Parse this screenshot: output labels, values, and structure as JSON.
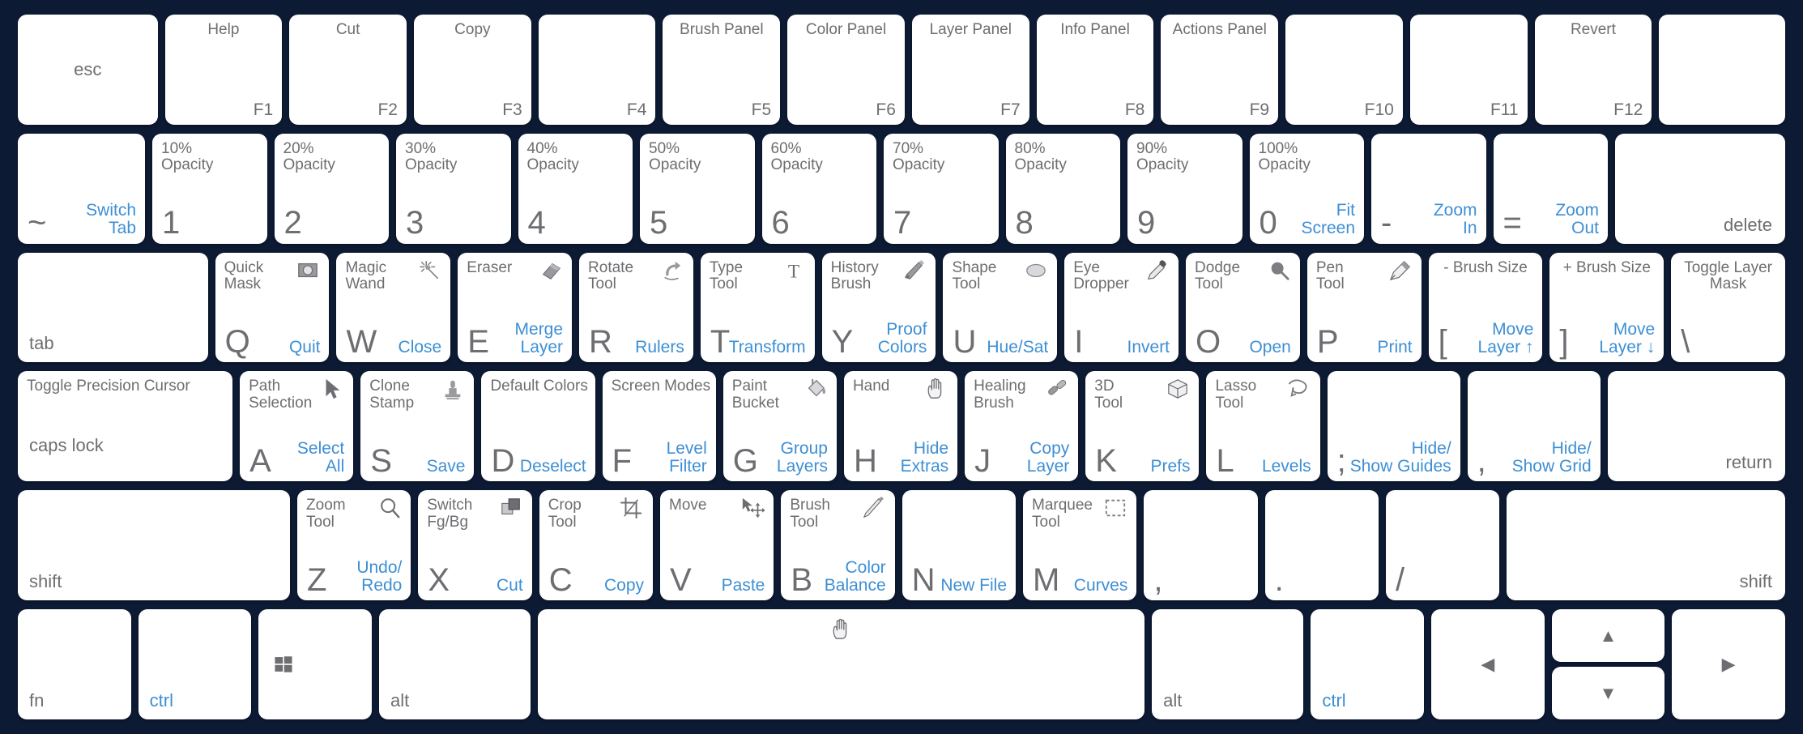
{
  "theme": {
    "background": "#0d1a33",
    "key_bg": "#ffffff",
    "text": "#6e6e72",
    "accent": "#3d8fd4",
    "icon": "#8a8a8e"
  },
  "rows": {
    "function_row": [
      {
        "key": "esc",
        "type": "plain-center",
        "label": "esc",
        "flex": 2.05
      },
      {
        "key": "F1",
        "type": "fn",
        "top": "Help",
        "code": "F1",
        "flex": 1.72
      },
      {
        "key": "F2",
        "type": "fn",
        "top": "Cut",
        "code": "F2",
        "flex": 1.72
      },
      {
        "key": "F3",
        "type": "fn",
        "top": "Copy",
        "code": "F3",
        "flex": 1.72
      },
      {
        "key": "F4",
        "type": "fn",
        "top": "",
        "code": "F4",
        "flex": 1.72
      },
      {
        "key": "F5",
        "type": "fn",
        "top": "Brush Panel",
        "code": "F5",
        "flex": 1.72
      },
      {
        "key": "F6",
        "type": "fn",
        "top": "Color Panel",
        "code": "F6",
        "flex": 1.72
      },
      {
        "key": "F7",
        "type": "fn",
        "top": "Layer Panel",
        "code": "F7",
        "flex": 1.72
      },
      {
        "key": "F8",
        "type": "fn",
        "top": "Info Panel",
        "code": "F8",
        "flex": 1.72
      },
      {
        "key": "F9",
        "type": "fn",
        "top": "Actions Panel",
        "code": "F9",
        "flex": 1.72
      },
      {
        "key": "F10",
        "type": "fn",
        "top": "",
        "code": "F10",
        "flex": 1.72
      },
      {
        "key": "F11",
        "type": "fn",
        "top": "",
        "code": "F11",
        "flex": 1.72
      },
      {
        "key": "F12",
        "type": "fn",
        "top": "Revert",
        "code": "F12",
        "flex": 1.72
      },
      {
        "key": "blank-fn",
        "type": "blank",
        "flex": 1.85
      }
    ],
    "number_row": [
      {
        "key": "tilde",
        "type": "tool",
        "glyph": "~",
        "action": "Switch\nTab",
        "flex": 1.72
      },
      {
        "key": "1",
        "type": "tool",
        "top": "10%\nOpacity",
        "glyph": "1",
        "flex": 1.55
      },
      {
        "key": "2",
        "type": "tool",
        "top": "20%\nOpacity",
        "glyph": "2",
        "flex": 1.55
      },
      {
        "key": "3",
        "type": "tool",
        "top": "30%\nOpacity",
        "glyph": "3",
        "flex": 1.55
      },
      {
        "key": "4",
        "type": "tool",
        "top": "40%\nOpacity",
        "glyph": "4",
        "flex": 1.55
      },
      {
        "key": "5",
        "type": "tool",
        "top": "50%\nOpacity",
        "glyph": "5",
        "flex": 1.55
      },
      {
        "key": "6",
        "type": "tool",
        "top": "60%\nOpacity",
        "glyph": "6",
        "flex": 1.55
      },
      {
        "key": "7",
        "type": "tool",
        "top": "70%\nOpacity",
        "glyph": "7",
        "flex": 1.55
      },
      {
        "key": "8",
        "type": "tool",
        "top": "80%\nOpacity",
        "glyph": "8",
        "flex": 1.55
      },
      {
        "key": "9",
        "type": "tool",
        "top": "90%\nOpacity",
        "glyph": "9",
        "flex": 1.55
      },
      {
        "key": "0",
        "type": "tool",
        "top": "100%\nOpacity",
        "glyph": "0",
        "action": "Fit\nScreen",
        "flex": 1.55
      },
      {
        "key": "minus",
        "type": "tool",
        "glyph": "-",
        "action": "Zoom\nIn",
        "flex": 1.55
      },
      {
        "key": "equal",
        "type": "tool",
        "glyph": "=",
        "action": "Zoom\nOut",
        "flex": 1.55
      },
      {
        "key": "delete",
        "type": "mod-right",
        "label": "delete",
        "flex": 2.3
      }
    ],
    "tab_row": [
      {
        "key": "tab",
        "type": "mod-left",
        "label": "tab",
        "flex": 2.45
      },
      {
        "key": "Q",
        "type": "tool",
        "top": "Quick\nMask",
        "icon": "quick-mask-icon",
        "glyph": "Q",
        "action": "Quit",
        "flex": 1.47
      },
      {
        "key": "W",
        "type": "tool",
        "top": "Magic\nWand",
        "icon": "magic-wand-icon",
        "glyph": "W",
        "action": "Close",
        "flex": 1.47
      },
      {
        "key": "E",
        "type": "tool",
        "top": "Eraser",
        "icon": "eraser-icon",
        "glyph": "E",
        "action": "Merge\nLayer",
        "flex": 1.47
      },
      {
        "key": "R",
        "type": "tool",
        "top": "Rotate\nTool",
        "icon": "rotate-icon",
        "glyph": "R",
        "action": "Rulers",
        "flex": 1.47
      },
      {
        "key": "T",
        "type": "tool",
        "top": "Type\nTool",
        "icon": "type-icon",
        "glyph": "T",
        "action": "Transform",
        "flex": 1.47
      },
      {
        "key": "Y",
        "type": "tool",
        "top": "History\nBrush",
        "icon": "history-brush-icon",
        "glyph": "Y",
        "action": "Proof\nColors",
        "flex": 1.47
      },
      {
        "key": "U",
        "type": "tool",
        "top": "Shape\nTool",
        "icon": "shape-icon",
        "glyph": "U",
        "action": "Hue/Sat",
        "flex": 1.47
      },
      {
        "key": "I",
        "type": "tool",
        "top": "Eye\nDropper",
        "icon": "eyedropper-icon",
        "glyph": "I",
        "action": "Invert",
        "flex": 1.47
      },
      {
        "key": "O",
        "type": "tool",
        "top": "Dodge\nTool",
        "icon": "dodge-icon",
        "glyph": "O",
        "action": "Open",
        "flex": 1.47
      },
      {
        "key": "P",
        "type": "tool",
        "top": "Pen\nTool",
        "icon": "pen-icon",
        "glyph": "P",
        "action": "Print",
        "flex": 1.47
      },
      {
        "key": "bracket-left",
        "type": "tool",
        "topc": "- Brush Size",
        "glyph": "[",
        "action": "Move\nLayer ↑",
        "flex": 1.47
      },
      {
        "key": "bracket-right",
        "type": "tool",
        "topc": "+ Brush Size",
        "glyph": "]",
        "action": "Move\nLayer ↓",
        "flex": 1.47
      },
      {
        "key": "backslash",
        "type": "tool",
        "topc": "Toggle Layer\nMask",
        "glyph": "\\",
        "flex": 1.47
      }
    ],
    "caps_row": [
      {
        "key": "caps lock",
        "type": "caps",
        "top": "Toggle Precision Cursor",
        "label": "caps lock",
        "flex": 2.78
      },
      {
        "key": "A",
        "type": "tool",
        "top": "Path\nSelection",
        "icon": "path-selection-icon",
        "glyph": "A",
        "action": "Select\nAll",
        "flex": 1.47
      },
      {
        "key": "S",
        "type": "tool",
        "top": "Clone\nStamp",
        "icon": "clone-stamp-icon",
        "glyph": "S",
        "action": "Save",
        "flex": 1.47
      },
      {
        "key": "D",
        "type": "tool",
        "top": "Default Colors",
        "glyph": "D",
        "action": "Deselect",
        "flex": 1.47
      },
      {
        "key": "F",
        "type": "tool",
        "top": "Screen Modes",
        "glyph": "F",
        "action": "Level\nFilter",
        "flex": 1.47
      },
      {
        "key": "G",
        "type": "tool",
        "top": "Paint\nBucket",
        "icon": "paint-bucket-icon",
        "glyph": "G",
        "action": "Group\nLayers",
        "flex": 1.47
      },
      {
        "key": "H",
        "type": "tool",
        "top": "Hand",
        "icon": "hand-icon",
        "glyph": "H",
        "action": "Hide\nExtras",
        "flex": 1.47
      },
      {
        "key": "J",
        "type": "tool",
        "top": "Healing\nBrush",
        "icon": "healing-brush-icon",
        "glyph": "J",
        "action": "Copy\nLayer",
        "flex": 1.47
      },
      {
        "key": "K",
        "type": "tool",
        "top": "3D\nTool",
        "icon": "cube-icon",
        "glyph": "K",
        "action": "Prefs",
        "flex": 1.47
      },
      {
        "key": "L",
        "type": "tool",
        "top": "Lasso\nTool",
        "icon": "lasso-icon",
        "glyph": "L",
        "action": "Levels",
        "flex": 1.47
      },
      {
        "key": "semicolon",
        "type": "tool",
        "glyph": ";",
        "action": "Hide/\nShow Guides",
        "flex": 1.72
      },
      {
        "key": "quote",
        "type": "tool",
        "glyph": ",",
        "action": "Hide/\nShow Grid",
        "flex": 1.72
      },
      {
        "key": "return",
        "type": "mod-right",
        "label": "return",
        "flex": 2.3
      }
    ],
    "shift_row": [
      {
        "key": "shift-left",
        "type": "mod-left",
        "label": "shift",
        "flex": 3.52
      },
      {
        "key": "Z",
        "type": "tool",
        "top": "Zoom\nTool",
        "icon": "zoom-tool-icon",
        "glyph": "Z",
        "action": "Undo/\nRedo",
        "flex": 1.47
      },
      {
        "key": "X",
        "type": "tool",
        "top": "Switch\nFg/Bg",
        "icon": "switch-fgbg-icon",
        "glyph": "X",
        "action": "Cut",
        "flex": 1.47
      },
      {
        "key": "C",
        "type": "tool",
        "top": "Crop\nTool",
        "icon": "crop-icon",
        "glyph": "C",
        "action": "Copy",
        "flex": 1.47
      },
      {
        "key": "V",
        "type": "tool",
        "top": "Move",
        "icon": "move-icon",
        "glyph": "V",
        "action": "Paste",
        "flex": 1.47
      },
      {
        "key": "B",
        "type": "tool",
        "top": "Brush\nTool",
        "icon": "brush-icon",
        "glyph": "B",
        "action": "Color\nBalance",
        "flex": 1.47
      },
      {
        "key": "N",
        "type": "tool",
        "glyph": "N",
        "action": "New File",
        "flex": 1.47
      },
      {
        "key": "M",
        "type": "tool",
        "top": "Marquee\nTool",
        "icon": "marquee-icon",
        "glyph": "M",
        "action": "Curves",
        "flex": 1.47
      },
      {
        "key": "comma",
        "type": "tool",
        "glyph": ",",
        "flex": 1.47
      },
      {
        "key": "period",
        "type": "tool",
        "glyph": ".",
        "flex": 1.47
      },
      {
        "key": "slash",
        "type": "tool",
        "glyph": "/",
        "flex": 1.47
      },
      {
        "key": "shift-right",
        "type": "mod-right",
        "label": "shift",
        "flex": 3.6
      }
    ],
    "space_row": [
      {
        "key": "fn",
        "type": "mod-left",
        "label": "fn",
        "flex": 1.38
      },
      {
        "key": "ctrl-left",
        "type": "mod-left",
        "label": "ctrl",
        "accent": true,
        "flex": 1.38
      },
      {
        "key": "win",
        "type": "mod-icon",
        "icon": "windows-icon",
        "flex": 1.38
      },
      {
        "key": "alt-left",
        "type": "mod-left",
        "label": "alt",
        "flex": 1.85
      },
      {
        "key": "space",
        "type": "space",
        "icon": "hand-icon",
        "flex": 7.4
      },
      {
        "key": "alt-right",
        "type": "mod-left",
        "label": "alt",
        "flex": 1.85
      },
      {
        "key": "ctrl-right",
        "type": "mod-left",
        "label": "ctrl",
        "accent": true,
        "flex": 1.38
      },
      {
        "key": "arrow-left",
        "type": "arrow",
        "glyph": "◀",
        "flex": 1.38
      },
      {
        "key": "arrow-updown",
        "type": "arrow-stack",
        "up": "▲",
        "down": "▼",
        "flex": 1.38
      },
      {
        "key": "arrow-right",
        "type": "arrow",
        "glyph": "▶",
        "flex": 1.38
      }
    ]
  }
}
